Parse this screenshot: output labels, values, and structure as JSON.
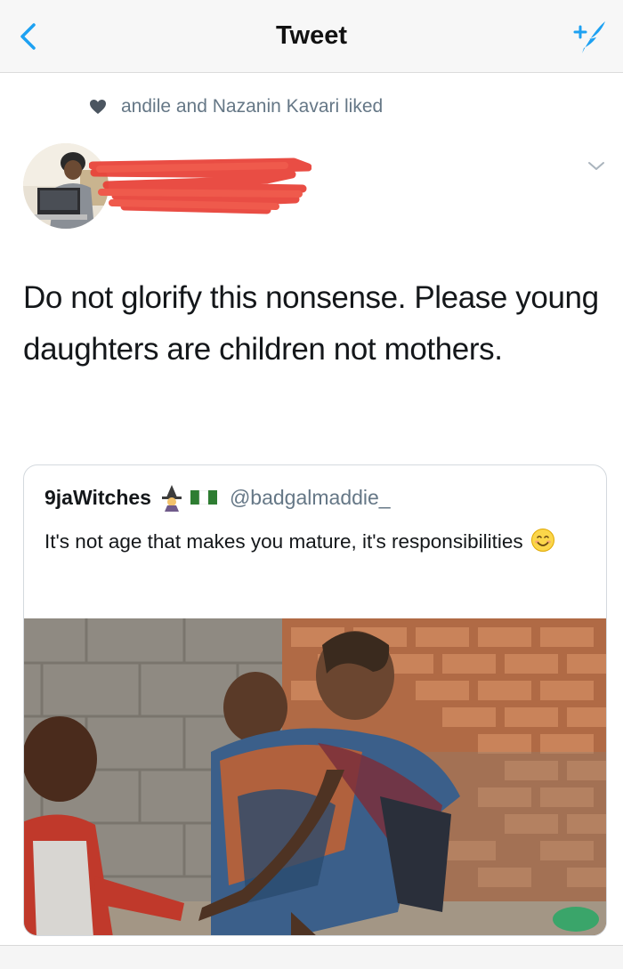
{
  "navbar": {
    "title": "Tweet",
    "back_icon": "chevron-left-icon",
    "compose_icon": "compose-tweet-icon",
    "accent_color": "#1da1f2"
  },
  "social_context": {
    "icon": "heart-icon",
    "text": "andile and Nazanin Kavari liked"
  },
  "tweet": {
    "author_name_redacted": true,
    "text": "Do not glorify this nonsense. Please young daughters are children not mothers.",
    "caret_icon": "chevron-down-icon"
  },
  "quoted_tweet": {
    "display_name": "9jaWitches",
    "name_emoji": [
      "witch-emoji",
      "nigeria-flag-emoji"
    ],
    "handle": "@badgalmaddie_",
    "text": "It's not age that makes you mature, it's responsibilities",
    "trailing_emoji": "smiling-face-emoji",
    "photo_description_icon": "photo-girl-carrying-baby"
  }
}
